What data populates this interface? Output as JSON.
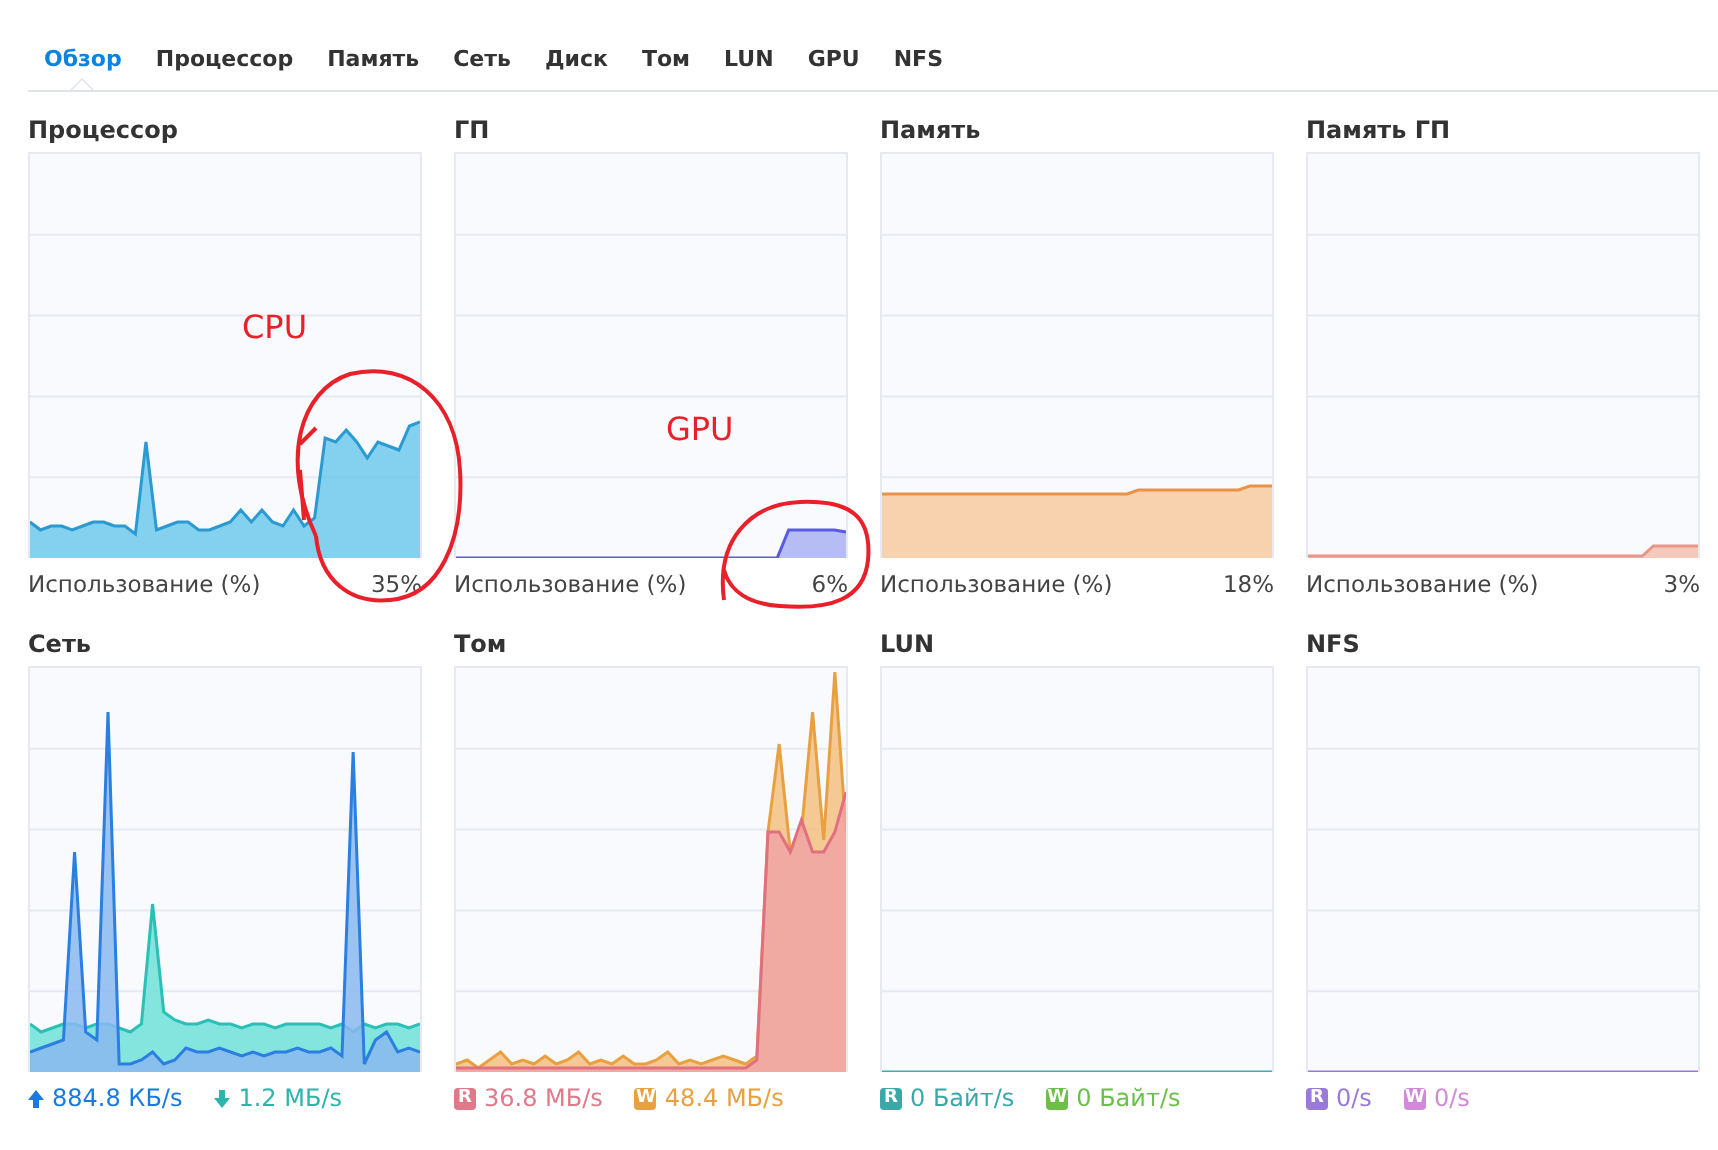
{
  "tabs": [
    {
      "label": "Обзор",
      "selected": true
    },
    {
      "label": "Процессор",
      "selected": false
    },
    {
      "label": "Память",
      "selected": false
    },
    {
      "label": "Сеть",
      "selected": false
    },
    {
      "label": "Диск",
      "selected": false
    },
    {
      "label": "Том",
      "selected": false
    },
    {
      "label": "LUN",
      "selected": false
    },
    {
      "label": "GPU",
      "selected": false
    },
    {
      "label": "NFS",
      "selected": false
    }
  ],
  "panels": [
    {
      "title": "Процессор",
      "kind": "usage",
      "label": "Использование (%)",
      "value": "35%"
    },
    {
      "title": "ГП",
      "kind": "usage",
      "label": "Использование (%)",
      "value": "6%"
    },
    {
      "title": "Память",
      "kind": "usage",
      "label": "Использование (%)",
      "value": "18%"
    },
    {
      "title": "Память ГП",
      "kind": "usage",
      "label": "Использование (%)",
      "value": "3%"
    },
    {
      "title": "Сеть",
      "kind": "io",
      "legend": [
        {
          "kind": "arrow-up",
          "value": "884.8 КБ/s",
          "color": "#1a7ae0"
        },
        {
          "kind": "arrow-down",
          "value": "1.2 МБ/s",
          "color": "#2bb5ad"
        }
      ]
    },
    {
      "title": "Том",
      "kind": "io",
      "legend": [
        {
          "kind": "badge",
          "badge": "R",
          "value": "36.8 МБ/s",
          "color": "#e07a8a"
        },
        {
          "kind": "badge",
          "badge": "W",
          "value": "48.4 МБ/s",
          "color": "#e8a040"
        }
      ]
    },
    {
      "title": "LUN",
      "kind": "io",
      "legend": [
        {
          "kind": "badge",
          "badge": "R",
          "value": "0 Байт/s",
          "color": "#3aa8a8"
        },
        {
          "kind": "badge",
          "badge": "W",
          "value": "0 Байт/s",
          "color": "#6cc04a"
        }
      ]
    },
    {
      "title": "NFS",
      "kind": "io",
      "legend": [
        {
          "kind": "badge",
          "badge": "R",
          "value": "0/s",
          "color": "#9a7ad8"
        },
        {
          "kind": "badge",
          "badge": "W",
          "value": "0/s",
          "color": "#d08ad8"
        }
      ]
    }
  ],
  "annotations": [
    {
      "text": "CPU"
    },
    {
      "text": "GPU"
    }
  ]
}
